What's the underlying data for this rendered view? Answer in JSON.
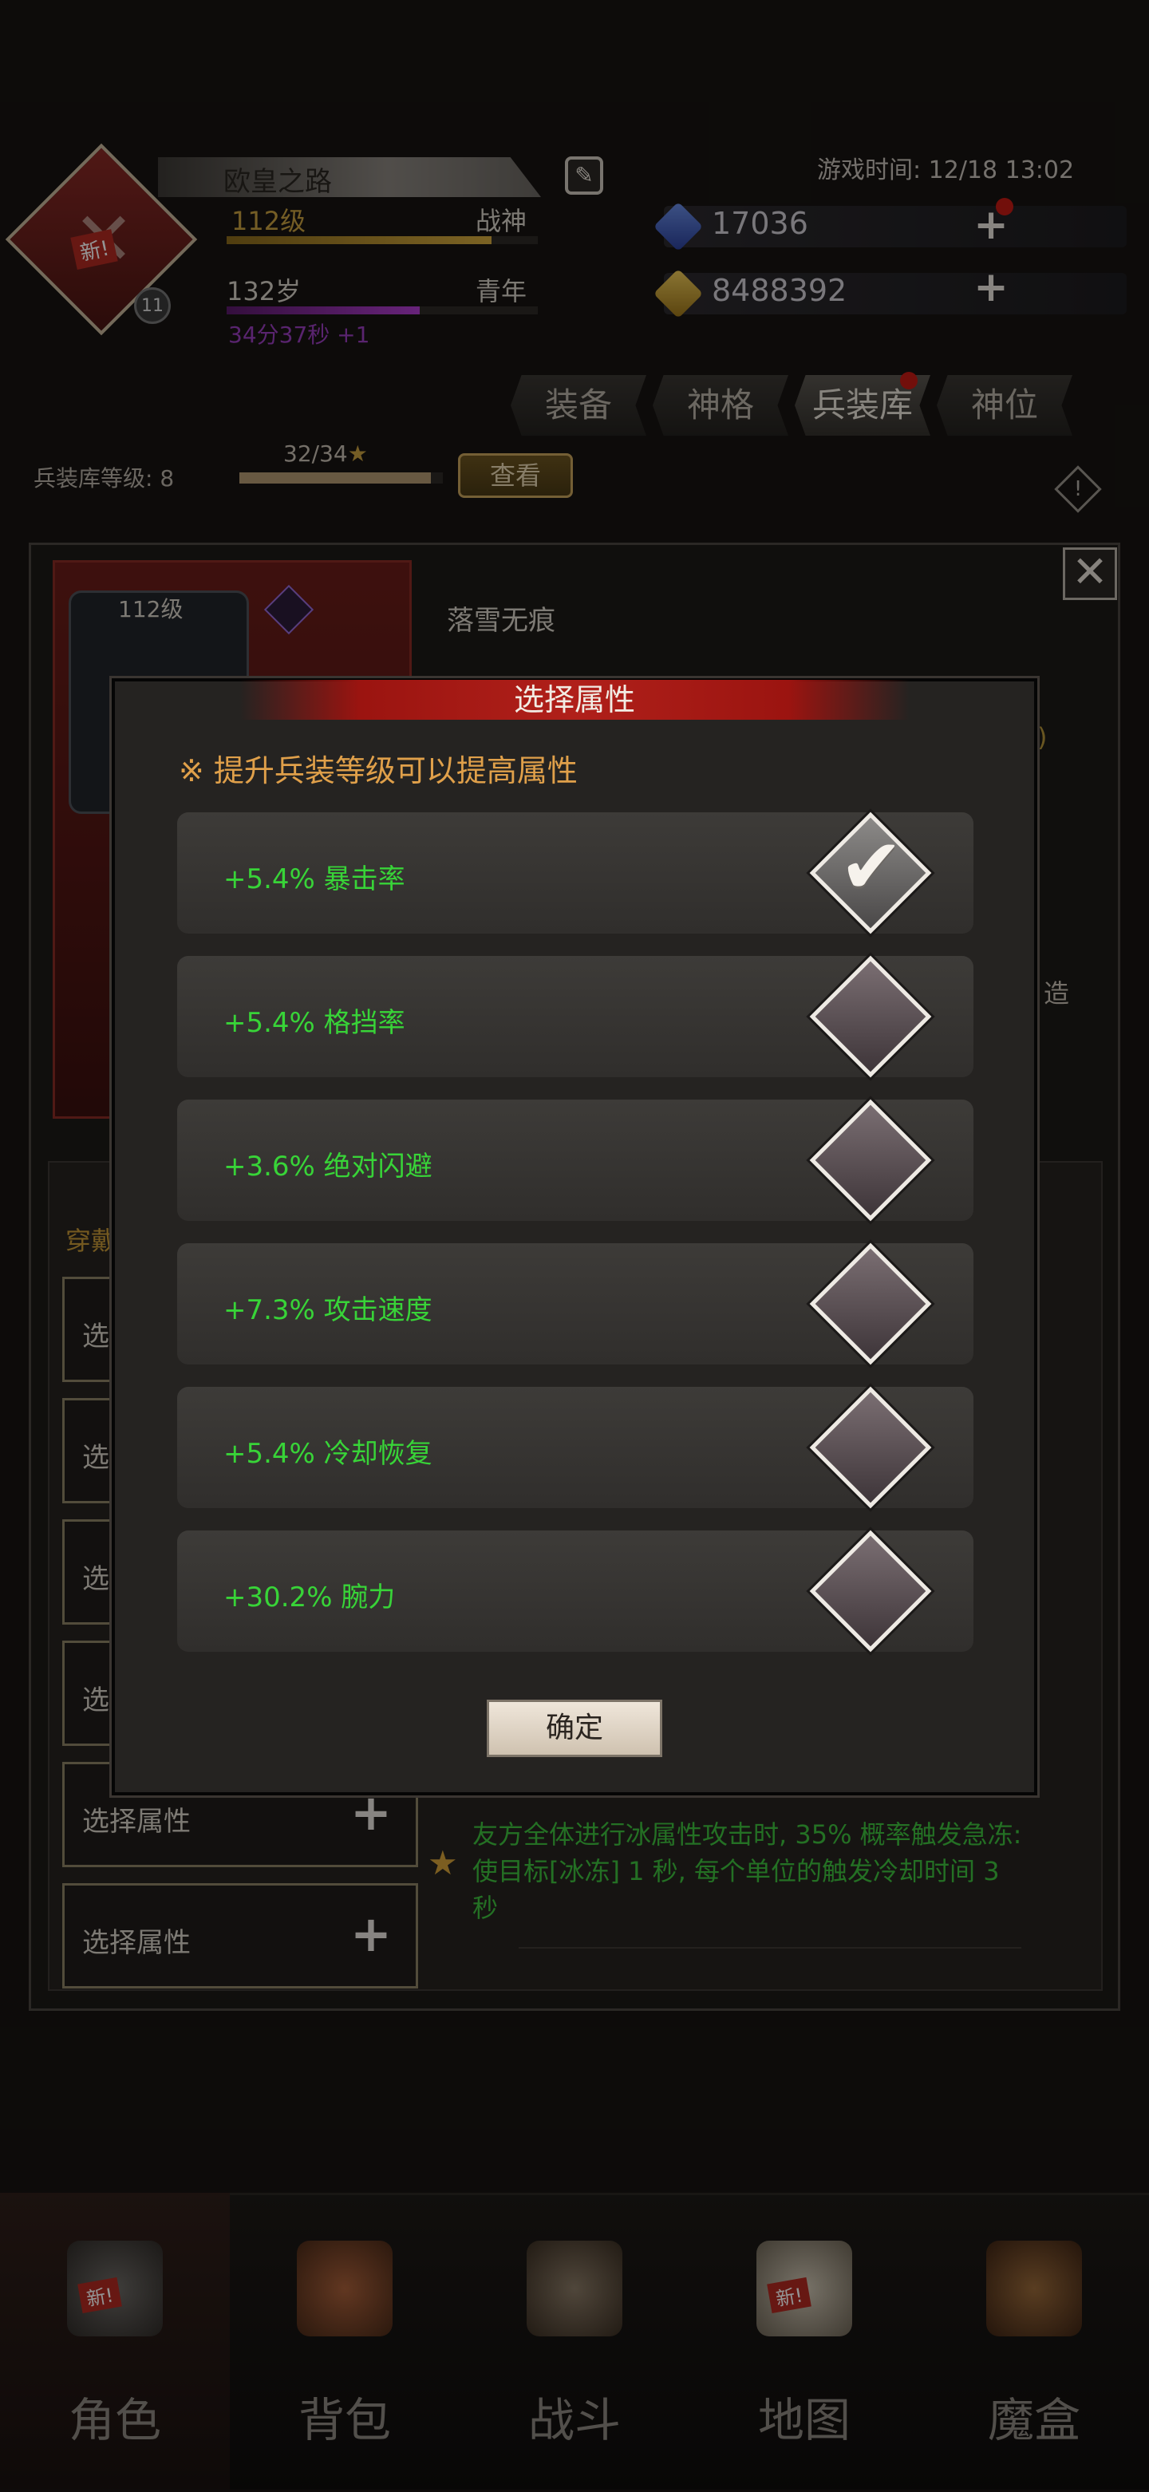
{
  "header": {
    "player_name": "欧皇之路",
    "game_time_label": "游戏时间: 12/18 13:02",
    "level": "112级",
    "level_title": "战神",
    "level_progress": 0.85,
    "age": "132岁",
    "age_title": "青年",
    "age_progress": 0.62,
    "age_timer": "34分37秒 +1",
    "emblem_badge": "新!",
    "emblem_level": "11",
    "resources": [
      {
        "icon": "blue-gem-icon",
        "value": "17036",
        "color": "#3f67c8"
      },
      {
        "icon": "gold-gem-icon",
        "value": "8488392",
        "color": "#d2a22a"
      }
    ]
  },
  "tabs": [
    "装备",
    "神格",
    "兵装库",
    "神位"
  ],
  "active_tab": "兵装库",
  "armory": {
    "level_label": "兵装库等级: 8",
    "progress": "32/34",
    "progress_value": 0.94,
    "view_button": "查看"
  },
  "background_panel": {
    "weapon_level": "112级",
    "weapon_name": "落雪无痕",
    "side_text": "造",
    "side_paren": ")",
    "wear_label": "穿戴",
    "slot_label": "选择属性",
    "slot_short": "选",
    "effect_text": "友方全体进行冰属性攻击时, 35% 概率触发急冻: 使目标[冰冻] 1 秒, 每个单位的触发冷却时间 3 秒"
  },
  "modal": {
    "title": "选择属性",
    "hint": "※ 提升兵装等级可以提高属性",
    "confirm_button": "确定",
    "attributes": [
      {
        "label": "+5.4%  暴击率",
        "checked": true
      },
      {
        "label": "+5.4%  格挡率",
        "checked": false
      },
      {
        "label": "+3.6%  绝对闪避",
        "checked": false
      },
      {
        "label": "+7.3%  攻击速度",
        "checked": false
      },
      {
        "label": "+5.4%  冷却恢复",
        "checked": false
      },
      {
        "label": "+30.2%  腕力",
        "checked": false
      }
    ]
  },
  "bottom_nav": [
    {
      "label": "角色",
      "icon": "helmet-icon",
      "badge": "新!"
    },
    {
      "label": "背包",
      "icon": "backpack-icon",
      "badge": ""
    },
    {
      "label": "战斗",
      "icon": "sword-shield-icon",
      "badge": ""
    },
    {
      "label": "地图",
      "icon": "scroll-map-icon",
      "badge": "新!"
    },
    {
      "label": "魔盒",
      "icon": "magic-box-icon",
      "badge": ""
    }
  ],
  "colors": {
    "accent_gold": "#c8a45c",
    "attribute_green": "#38d438",
    "title_red": "#b0201a",
    "hint_orange": "#e0a04a"
  }
}
